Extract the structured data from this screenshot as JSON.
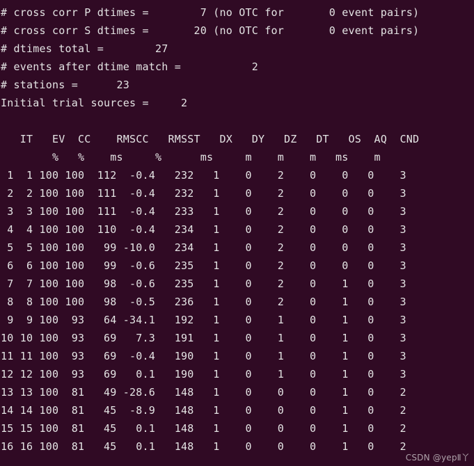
{
  "terminal": {
    "background_color": "#300a24",
    "foreground_color": "#e4e4e4",
    "summary_lines": [
      "# cross corr P dtimes =        7 (no OTC for       0 event pairs)",
      "# cross corr S dtimes =       20 (no OTC for       0 event pairs)",
      "# dtimes total =        27",
      "# events after dtime match =           2",
      "# stations =      23",
      "Initial trial sources =     2"
    ],
    "summary_values": {
      "cross_corr_P_dtimes": "7",
      "cross_corr_P_no_OTC_event_pairs": "0",
      "cross_corr_S_dtimes": "20",
      "cross_corr_S_no_OTC_event_pairs": "0",
      "dtimes_total": "27",
      "events_after_dtime_match": "2",
      "stations": "23",
      "initial_trial_sources": "2"
    },
    "table": {
      "header_line": "   IT   EV  CC    RMSCC   RMSST   DX   DY   DZ   DT   OS  AQ  CND",
      "units_line": "        %   %    ms     %      ms     m    m    m   ms    m",
      "columns": [
        "IT",
        "EV",
        "CC",
        "RMSCC",
        "RMSST",
        "DX",
        "DY",
        "DZ",
        "DT",
        "OS",
        "AQ",
        "CND"
      ],
      "units": [
        "",
        "",
        "%",
        "%",
        "ms",
        "%",
        "ms",
        "m",
        "m",
        "m",
        "ms",
        "m",
        "",
        ""
      ],
      "rows": [
        " 1  1 100 100  112  -0.4   232   1    0    2    0    0   0    3",
        " 2  2 100 100  111  -0.4   232   1    0    2    0    0   0    3",
        " 3  3 100 100  111  -0.4   233   1    0    2    0    0   0    3",
        " 4  4 100 100  110  -0.4   234   1    0    2    0    0   0    3",
        " 5  5 100 100   99 -10.0   234   1    0    2    0    0   0    3",
        " 6  6 100 100   99  -0.6   235   1    0    2    0    0   0    3",
        " 7  7 100 100   98  -0.6   235   1    0    2    0    1   0    3",
        " 8  8 100 100   98  -0.5   236   1    0    2    0    1   0    3",
        " 9  9 100  93   64 -34.1   192   1    0    1    0    1   0    3",
        "10 10 100  93   69   7.3   191   1    0    1    0    1   0    3",
        "11 11 100  93   69  -0.4   190   1    0    1    0    1   0    3",
        "12 12 100  93   69   0.1   190   1    0    1    0    1   0    3",
        "13 13 100  81   49 -28.6   148   1    0    0    0    1   0    2",
        "14 14 100  81   45  -8.9   148   1    0    0    0    1   0    2",
        "15 15 100  81   45   0.1   148   1    0    0    0    1   0    2",
        "16 16 100  81   45   0.1   148   1    0    0    0    1   0    2"
      ],
      "row_values": [
        {
          "IT": "1",
          "EV": "1",
          "CC": "100",
          "RMSCC_ms": "100",
          "RMSCC_pct": "112",
          "d_pct": "-0.4",
          "RMSST_ms": "232",
          "DX": "1",
          "DY": "0",
          "DZ": "2",
          "DT": "0",
          "OS": "0",
          "AQ": "0",
          "CND": "3"
        },
        {
          "IT": "2",
          "EV": "2",
          "CC": "100",
          "RMSCC_ms": "100",
          "RMSCC_pct": "111",
          "d_pct": "-0.4",
          "RMSST_ms": "232",
          "DX": "1",
          "DY": "0",
          "DZ": "2",
          "DT": "0",
          "OS": "0",
          "AQ": "0",
          "CND": "3"
        },
        {
          "IT": "3",
          "EV": "3",
          "CC": "100",
          "RMSCC_ms": "100",
          "RMSCC_pct": "111",
          "d_pct": "-0.4",
          "RMSST_ms": "233",
          "DX": "1",
          "DY": "0",
          "DZ": "2",
          "DT": "0",
          "OS": "0",
          "AQ": "0",
          "CND": "3"
        },
        {
          "IT": "4",
          "EV": "4",
          "CC": "100",
          "RMSCC_ms": "100",
          "RMSCC_pct": "110",
          "d_pct": "-0.4",
          "RMSST_ms": "234",
          "DX": "1",
          "DY": "0",
          "DZ": "2",
          "DT": "0",
          "OS": "0",
          "AQ": "0",
          "CND": "3"
        },
        {
          "IT": "5",
          "EV": "5",
          "CC": "100",
          "RMSCC_ms": "100",
          "RMSCC_pct": "99",
          "d_pct": "-10.0",
          "RMSST_ms": "234",
          "DX": "1",
          "DY": "0",
          "DZ": "2",
          "DT": "0",
          "OS": "0",
          "AQ": "0",
          "CND": "3"
        },
        {
          "IT": "6",
          "EV": "6",
          "CC": "100",
          "RMSCC_ms": "100",
          "RMSCC_pct": "99",
          "d_pct": "-0.6",
          "RMSST_ms": "235",
          "DX": "1",
          "DY": "0",
          "DZ": "2",
          "DT": "0",
          "OS": "0",
          "AQ": "0",
          "CND": "3"
        },
        {
          "IT": "7",
          "EV": "7",
          "CC": "100",
          "RMSCC_ms": "100",
          "RMSCC_pct": "98",
          "d_pct": "-0.6",
          "RMSST_ms": "235",
          "DX": "1",
          "DY": "0",
          "DZ": "2",
          "DT": "0",
          "OS": "1",
          "AQ": "0",
          "CND": "3"
        },
        {
          "IT": "8",
          "EV": "8",
          "CC": "100",
          "RMSCC_ms": "100",
          "RMSCC_pct": "98",
          "d_pct": "-0.5",
          "RMSST_ms": "236",
          "DX": "1",
          "DY": "0",
          "DZ": "2",
          "DT": "0",
          "OS": "1",
          "AQ": "0",
          "CND": "3"
        },
        {
          "IT": "9",
          "EV": "9",
          "CC": "100",
          "RMSCC_ms": "93",
          "RMSCC_pct": "64",
          "d_pct": "-34.1",
          "RMSST_ms": "192",
          "DX": "1",
          "DY": "0",
          "DZ": "1",
          "DT": "0",
          "OS": "1",
          "AQ": "0",
          "CND": "3"
        },
        {
          "IT": "10",
          "EV": "10",
          "CC": "100",
          "RMSCC_ms": "93",
          "RMSCC_pct": "69",
          "d_pct": "7.3",
          "RMSST_ms": "191",
          "DX": "1",
          "DY": "0",
          "DZ": "1",
          "DT": "0",
          "OS": "1",
          "AQ": "0",
          "CND": "3"
        },
        {
          "IT": "11",
          "EV": "11",
          "CC": "100",
          "RMSCC_ms": "93",
          "RMSCC_pct": "69",
          "d_pct": "-0.4",
          "RMSST_ms": "190",
          "DX": "1",
          "DY": "0",
          "DZ": "1",
          "DT": "0",
          "OS": "1",
          "AQ": "0",
          "CND": "3"
        },
        {
          "IT": "12",
          "EV": "12",
          "CC": "100",
          "RMSCC_ms": "93",
          "RMSCC_pct": "69",
          "d_pct": "0.1",
          "RMSST_ms": "190",
          "DX": "1",
          "DY": "0",
          "DZ": "1",
          "DT": "0",
          "OS": "1",
          "AQ": "0",
          "CND": "3"
        },
        {
          "IT": "13",
          "EV": "13",
          "CC": "100",
          "RMSCC_ms": "81",
          "RMSCC_pct": "49",
          "d_pct": "-28.6",
          "RMSST_ms": "148",
          "DX": "1",
          "DY": "0",
          "DZ": "0",
          "DT": "0",
          "OS": "1",
          "AQ": "0",
          "CND": "2"
        },
        {
          "IT": "14",
          "EV": "14",
          "CC": "100",
          "RMSCC_ms": "81",
          "RMSCC_pct": "45",
          "d_pct": "-8.9",
          "RMSST_ms": "148",
          "DX": "1",
          "DY": "0",
          "DZ": "0",
          "DT": "0",
          "OS": "1",
          "AQ": "0",
          "CND": "2"
        },
        {
          "IT": "15",
          "EV": "15",
          "CC": "100",
          "RMSCC_ms": "81",
          "RMSCC_pct": "45",
          "d_pct": "0.1",
          "RMSST_ms": "148",
          "DX": "1",
          "DY": "0",
          "DZ": "0",
          "DT": "0",
          "OS": "1",
          "AQ": "0",
          "CND": "2"
        },
        {
          "IT": "16",
          "EV": "16",
          "CC": "100",
          "RMSCC_ms": "81",
          "RMSCC_pct": "45",
          "d_pct": "0.1",
          "RMSST_ms": "148",
          "DX": "1",
          "DY": "0",
          "DZ": "0",
          "DT": "0",
          "OS": "1",
          "AQ": "0",
          "CND": "2"
        }
      ]
    }
  },
  "watermark": {
    "text": "CSDN @yepⅡ丫"
  }
}
